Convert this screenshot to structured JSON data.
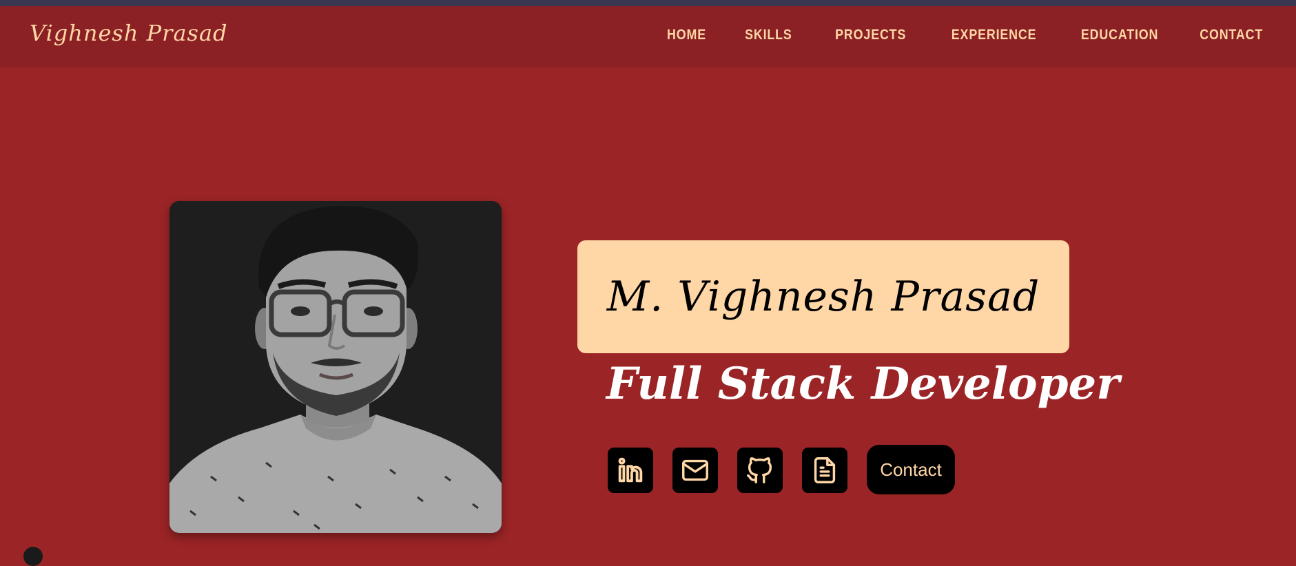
{
  "header": {
    "brand": "Vighnesh Prasad",
    "nav": [
      "HOME",
      "SKILLS",
      "PROJECTS",
      "EXPERIENCE",
      "EDUCATION",
      "CONTACT"
    ]
  },
  "hero": {
    "name": "M. Vighnesh Prasad",
    "title": "Full Stack Developer",
    "social_icons": [
      "linkedin-icon",
      "email-icon",
      "github-icon",
      "resume-icon"
    ],
    "contact_button": "Contact"
  },
  "colors": {
    "background": "#9b2426",
    "navbar": "#8b2124",
    "accent": "#ffd6a6",
    "top_strip": "#3a3550",
    "button": "#000000"
  }
}
